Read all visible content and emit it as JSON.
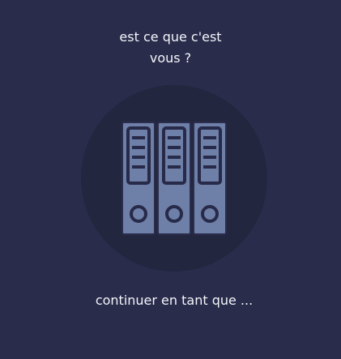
{
  "prompt": {
    "line1": "est ce que c'est",
    "line2": "vous ?"
  },
  "avatar": {
    "icon": "binders-icon",
    "colors": {
      "circle": "#23263f",
      "binder": "#6e7fa8",
      "binder_dark": "#272a48"
    }
  },
  "action": {
    "continue_label": "continuer en tant que ..."
  }
}
